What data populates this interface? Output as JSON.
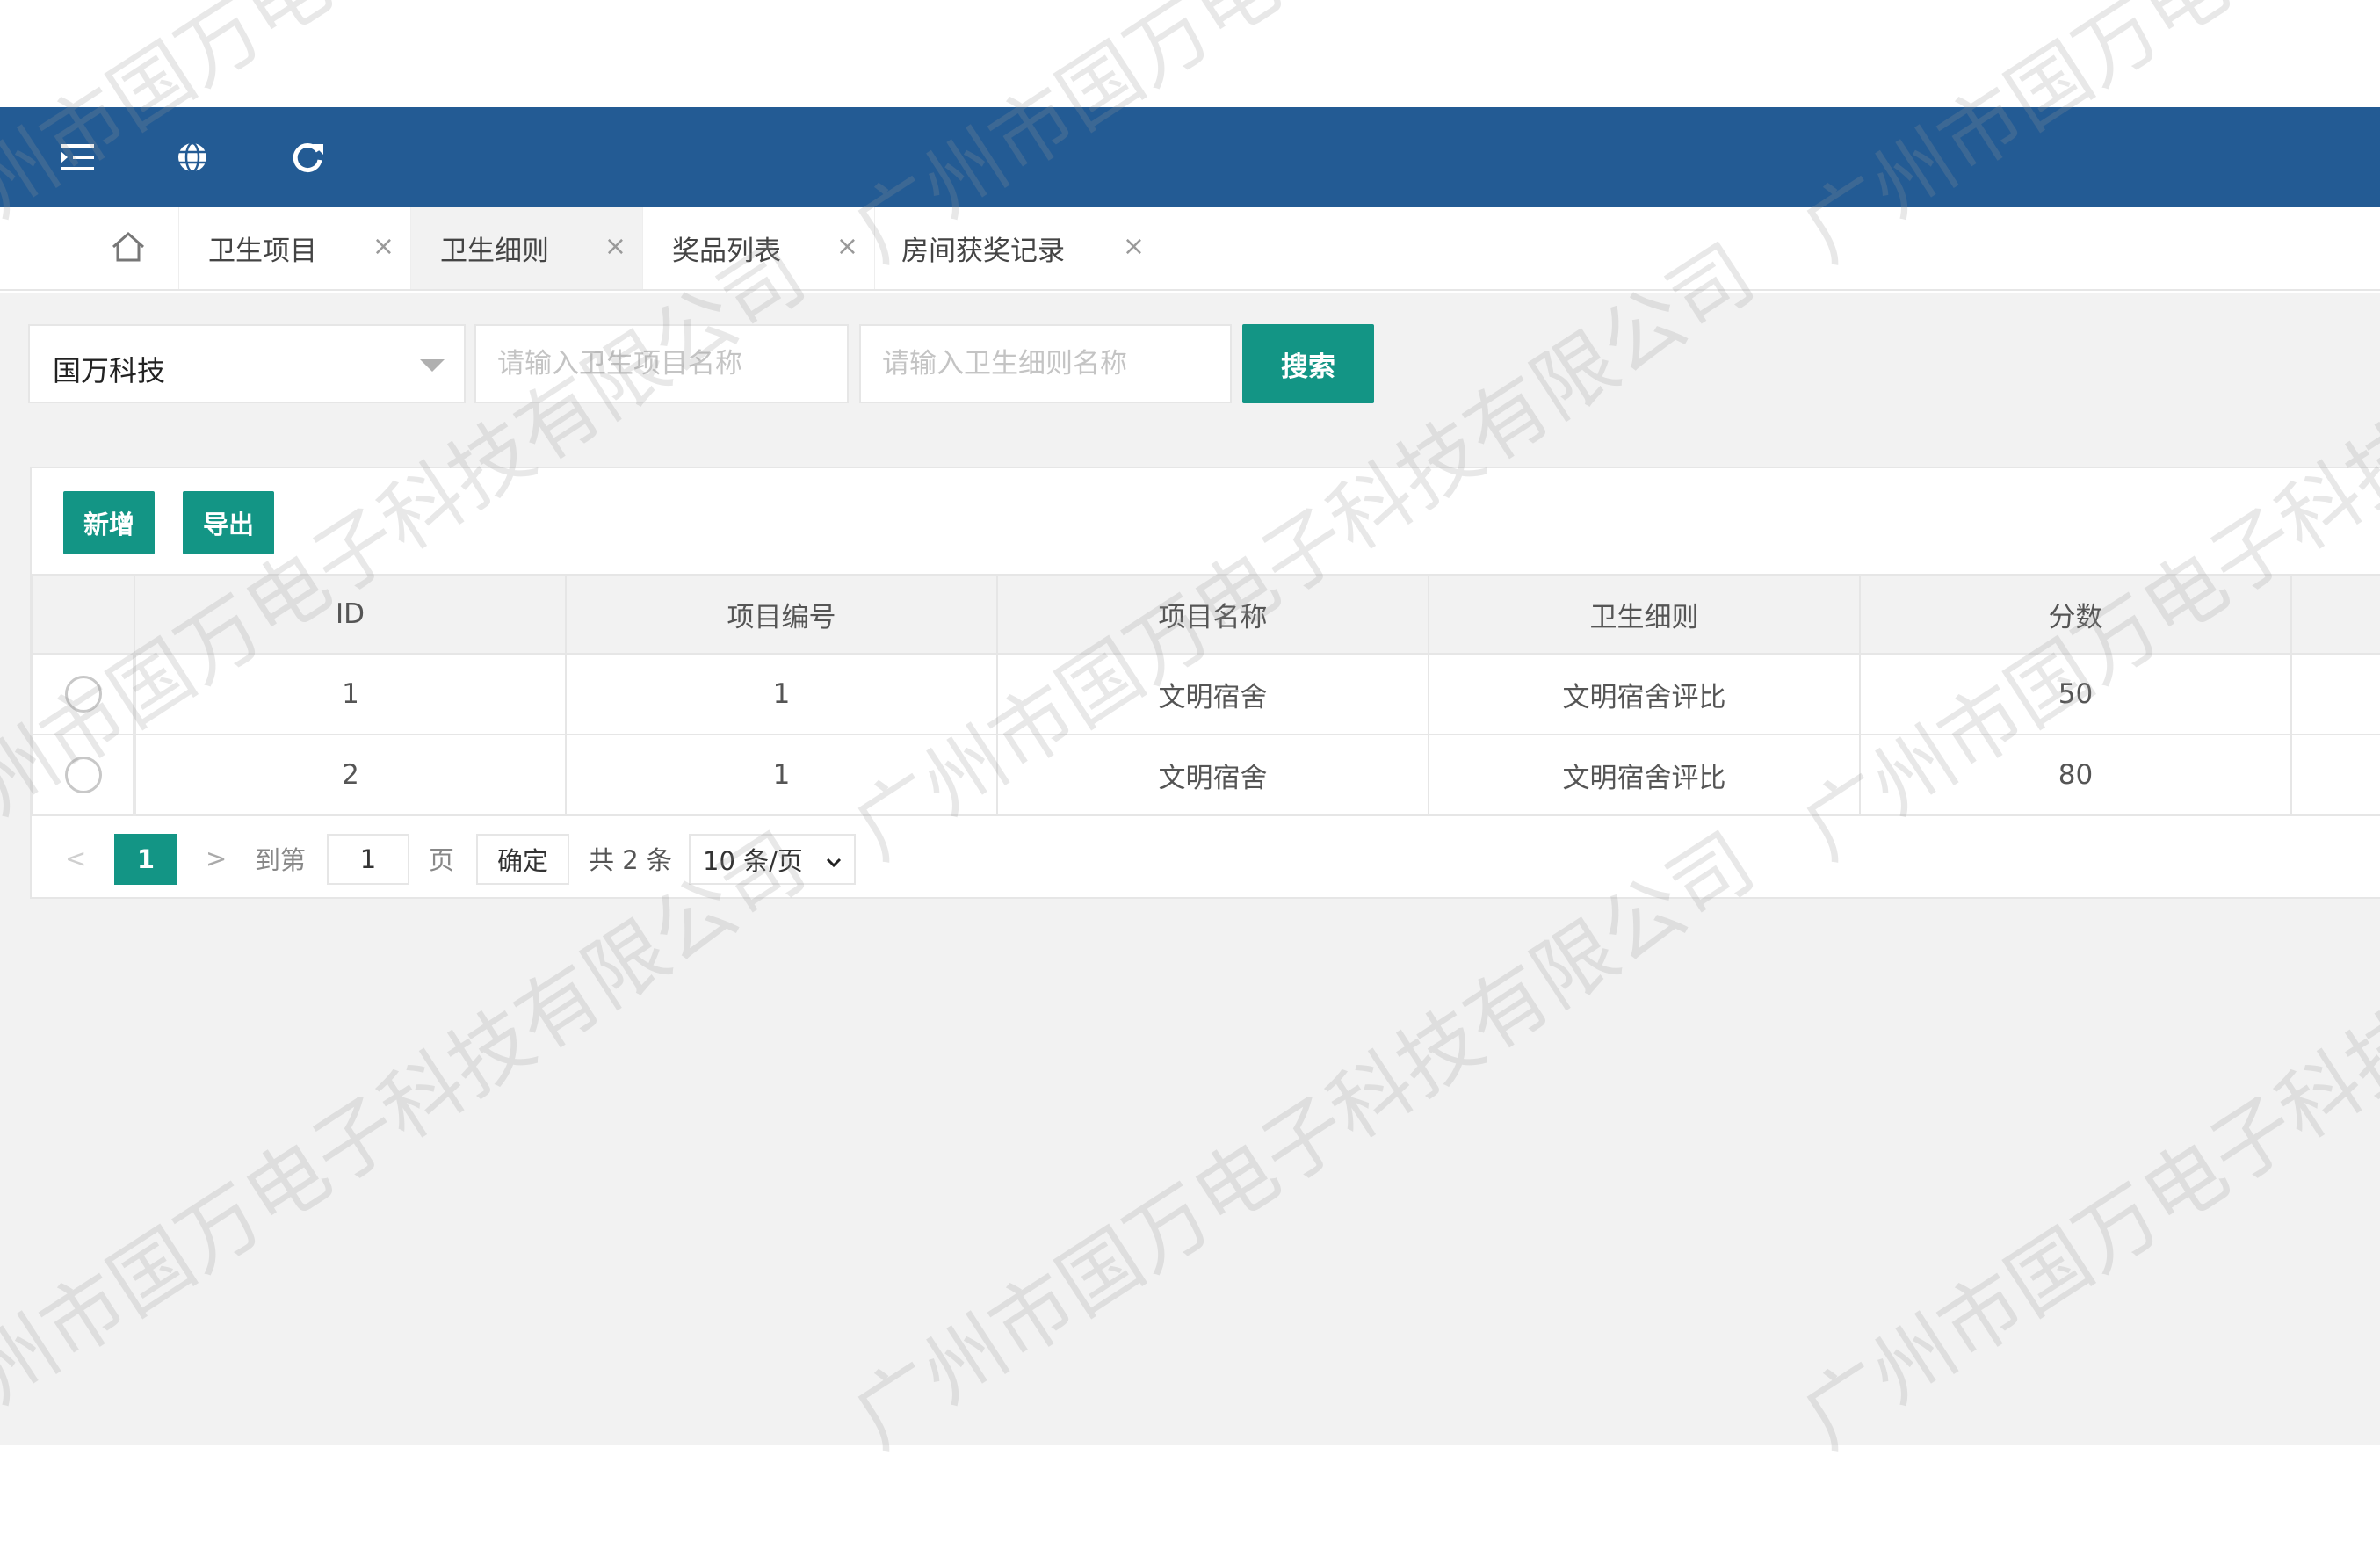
{
  "topbar": {
    "icons": [
      "menu-fold-icon",
      "globe-icon",
      "refresh-icon"
    ],
    "bg_color": "#235b94"
  },
  "tabs": [
    {
      "label": "卫生项目",
      "active": false
    },
    {
      "label": "卫生细则",
      "active": true
    },
    {
      "label": "奖品列表",
      "active": false
    },
    {
      "label": "房间获奖记录",
      "active": false
    }
  ],
  "tab_close": "×",
  "search": {
    "company_value": "国万科技",
    "project_placeholder": "请输入卫生项目名称",
    "rule_placeholder": "请输入卫生细则名称",
    "search_label": "搜索"
  },
  "toolbar": {
    "add_label": "新增",
    "export_label": "导出"
  },
  "table": {
    "columns": [
      "ID",
      "项目编号",
      "项目名称",
      "卫生细则",
      "分数"
    ],
    "rows": [
      [
        "1",
        "1",
        "文明宿舍",
        "文明宿舍评比",
        "50"
      ],
      [
        "2",
        "1",
        "文明宿舍",
        "文明宿舍评比",
        "80"
      ]
    ]
  },
  "pagination": {
    "prev": "<",
    "current_page": "1",
    "next": ">",
    "goto_label": "到第",
    "goto_value": "1",
    "page_unit": "页",
    "confirm_label": "确定",
    "total_text": "共 2 条",
    "page_size": "10 条/页"
  },
  "watermark": {
    "text": "广州市国万电子科技有限公司"
  },
  "colors": {
    "accent": "#139585",
    "header": "#235b94",
    "background": "#f2f2f2"
  }
}
